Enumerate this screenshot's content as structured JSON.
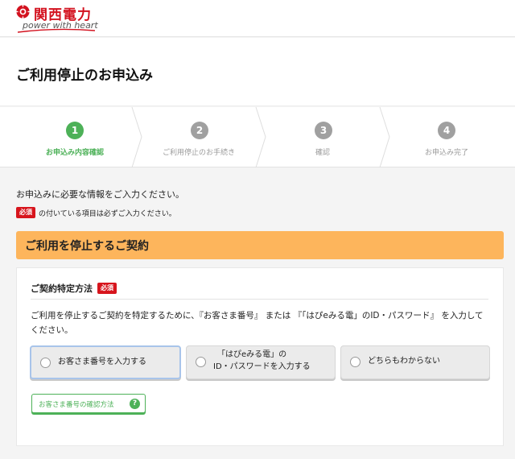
{
  "header": {
    "brand_name": "関西電力",
    "slogan": "power with heart"
  },
  "page": {
    "title": "ご利用停止のお申込み"
  },
  "steps": [
    {
      "number": "1",
      "label": "お申込み内容確認",
      "active": true
    },
    {
      "number": "2",
      "label": "ご利用停止のお手続き",
      "active": false
    },
    {
      "number": "3",
      "label": "確認",
      "active": false
    },
    {
      "number": "4",
      "label": "お申込み完了",
      "active": false
    }
  ],
  "form": {
    "intro": "お申込みに必要な情報をご入力ください。",
    "required_badge": "必須",
    "required_note": "の付いている項目は必ずご入力ください。",
    "section_title": "ご利用を停止するご契約",
    "card": {
      "heading": "ご契約特定方法",
      "description": "ご利用を停止するご契約を特定するために、『お客さま番号』 または 『「はぴeみる電」のID・パスワード』 を入力してください。",
      "options": [
        {
          "line1": "お客さま番号を入力する",
          "line2": "",
          "selected": true
        },
        {
          "line1": "「はぴeみる電」の",
          "line2": "ID・パスワードを入力する",
          "selected": false
        },
        {
          "line1": "どちらもわからない",
          "line2": "",
          "selected": false
        }
      ],
      "help_button": "お客さま番号の確認方法",
      "help_icon": "?"
    }
  },
  "colors": {
    "brand_red": "#d3121f",
    "accent_green": "#4db158",
    "section_orange": "#fdb55c",
    "selected_border": "#a8c4ea"
  }
}
